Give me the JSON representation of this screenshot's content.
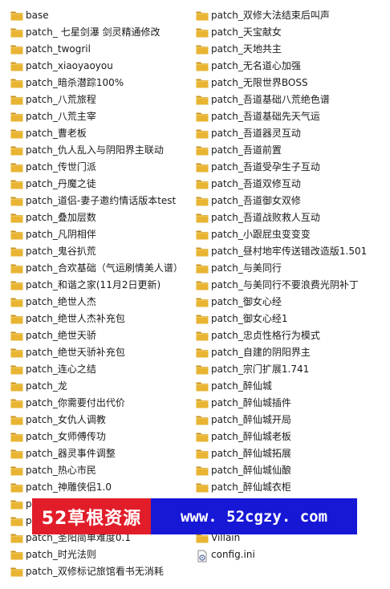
{
  "left_items": [
    {
      "label": "base",
      "icon": "folder-icon"
    },
    {
      "label": "patch_ 七星剑瀑 剑灵精通修改",
      "icon": "folder-icon"
    },
    {
      "label": "patch_twogril",
      "icon": "folder-icon"
    },
    {
      "label": "patch_xiaoyaoyou",
      "icon": "folder-icon"
    },
    {
      "label": "patch_暗杀潜踪100%",
      "icon": "folder-icon"
    },
    {
      "label": "patch_八荒旅程",
      "icon": "folder-icon"
    },
    {
      "label": "patch_八荒主宰",
      "icon": "folder-icon"
    },
    {
      "label": "patch_曹老板",
      "icon": "folder-icon"
    },
    {
      "label": "patch_仇人乱入与阴阳界主联动",
      "icon": "folder-icon"
    },
    {
      "label": "patch_传世门派",
      "icon": "folder-icon"
    },
    {
      "label": "patch_丹魔之徒",
      "icon": "folder-icon"
    },
    {
      "label": "patch_道侣-妻子邀约情话版本test",
      "icon": "folder-icon"
    },
    {
      "label": "patch_叠加层数",
      "icon": "folder-icon"
    },
    {
      "label": "patch_凡阴相伴",
      "icon": "folder-icon"
    },
    {
      "label": "patch_鬼谷扒荒",
      "icon": "folder-icon"
    },
    {
      "label": "patch_合欢基础（气运刷情美人谱）",
      "icon": "folder-icon"
    },
    {
      "label": "patch_和谐之家(11月2日更新)",
      "icon": "folder-icon"
    },
    {
      "label": "patch_绝世人杰",
      "icon": "folder-icon"
    },
    {
      "label": "patch_绝世人杰补充包",
      "icon": "folder-icon"
    },
    {
      "label": "patch_绝世天骄",
      "icon": "folder-icon"
    },
    {
      "label": "patch_绝世天骄补充包",
      "icon": "folder-icon"
    },
    {
      "label": "patch_连心之结",
      "icon": "folder-icon"
    },
    {
      "label": "patch_龙",
      "icon": "folder-icon"
    },
    {
      "label": "patch_你需要付出代价",
      "icon": "folder-icon"
    },
    {
      "label": "patch_女仇人调教",
      "icon": "folder-icon"
    },
    {
      "label": "patch_女师傅传功",
      "icon": "folder-icon"
    },
    {
      "label": "patch_器灵事件调整",
      "icon": "folder-icon"
    },
    {
      "label": "patch_热心市民",
      "icon": "folder-icon"
    },
    {
      "label": "patch_神雕侠侣1.0",
      "icon": "folder-icon"
    },
    {
      "label": "p",
      "icon": "folder-icon"
    },
    {
      "label": "p",
      "icon": "folder-icon"
    },
    {
      "label": "patch_圣阳简单难度0.1",
      "icon": "folder-icon"
    },
    {
      "label": "patch_时光法则",
      "icon": "folder-icon"
    },
    {
      "label": "patch_双修标记旅馆看书无消耗",
      "icon": "folder-icon"
    }
  ],
  "right_items": [
    {
      "label": "patch_双修大法结束后叫声",
      "icon": "folder-icon"
    },
    {
      "label": "patch_天宝献女",
      "icon": "folder-icon"
    },
    {
      "label": "patch_天地共主",
      "icon": "folder-icon"
    },
    {
      "label": "patch_无名道心加强",
      "icon": "folder-icon"
    },
    {
      "label": "patch_无限世界BOSS",
      "icon": "folder-icon"
    },
    {
      "label": "patch_吾道基础八荒绝色谱",
      "icon": "folder-icon"
    },
    {
      "label": "patch_吾道基础先天气运",
      "icon": "folder-icon"
    },
    {
      "label": "patch_吾道器灵互动",
      "icon": "folder-icon"
    },
    {
      "label": "patch_吾道前置",
      "icon": "folder-icon"
    },
    {
      "label": "patch_吾道受孕生子互动",
      "icon": "folder-icon"
    },
    {
      "label": "patch_吾道双修互动",
      "icon": "folder-icon"
    },
    {
      "label": "patch_吾道御女双修",
      "icon": "folder-icon"
    },
    {
      "label": "patch_吾道战败救人互动",
      "icon": "folder-icon"
    },
    {
      "label": "patch_小跟屁虫变变变",
      "icon": "folder-icon"
    },
    {
      "label": "patch_昼村地牢传送错改造版1.501",
      "icon": "folder-icon"
    },
    {
      "label": "patch_与美同行",
      "icon": "folder-icon"
    },
    {
      "label": "patch_与美同行不要浪费光阴补丁",
      "icon": "folder-icon"
    },
    {
      "label": "patch_御女心经",
      "icon": "folder-icon"
    },
    {
      "label": "patch_御女心经1",
      "icon": "folder-icon"
    },
    {
      "label": "patch_忠贞性格行为模式",
      "icon": "folder-icon"
    },
    {
      "label": "patch_自建的阴阳界主",
      "icon": "folder-icon"
    },
    {
      "label": "patch_宗门扩展1.741",
      "icon": "folder-icon"
    },
    {
      "label": "patch_醉仙城",
      "icon": "folder-icon"
    },
    {
      "label": "patch_醉仙城插件",
      "icon": "folder-icon"
    },
    {
      "label": "patch_醉仙城开局",
      "icon": "folder-icon"
    },
    {
      "label": "patch_醉仙城老板",
      "icon": "folder-icon"
    },
    {
      "label": "patch_醉仙城拓展",
      "icon": "folder-icon"
    },
    {
      "label": "patch_醉仙城仙酿",
      "icon": "folder-icon"
    },
    {
      "label": "patch_醉仙城衣柜",
      "icon": "folder-icon"
    },
    {
      "label": "",
      "icon": "folder-icon"
    },
    {
      "label": "",
      "icon": "folder-icon"
    },
    {
      "label": "Villain",
      "icon": "folder-icon"
    },
    {
      "label": "config.ini",
      "icon": "config-file-icon"
    }
  ],
  "watermark": {
    "brand": "52草根资源",
    "url": "www. 52cgzy. com"
  },
  "colors": {
    "folder": "#e8b432",
    "folder_dark": "#c9921a",
    "brand_bg": "#e21d2a",
    "url_bg": "#1717d6"
  }
}
